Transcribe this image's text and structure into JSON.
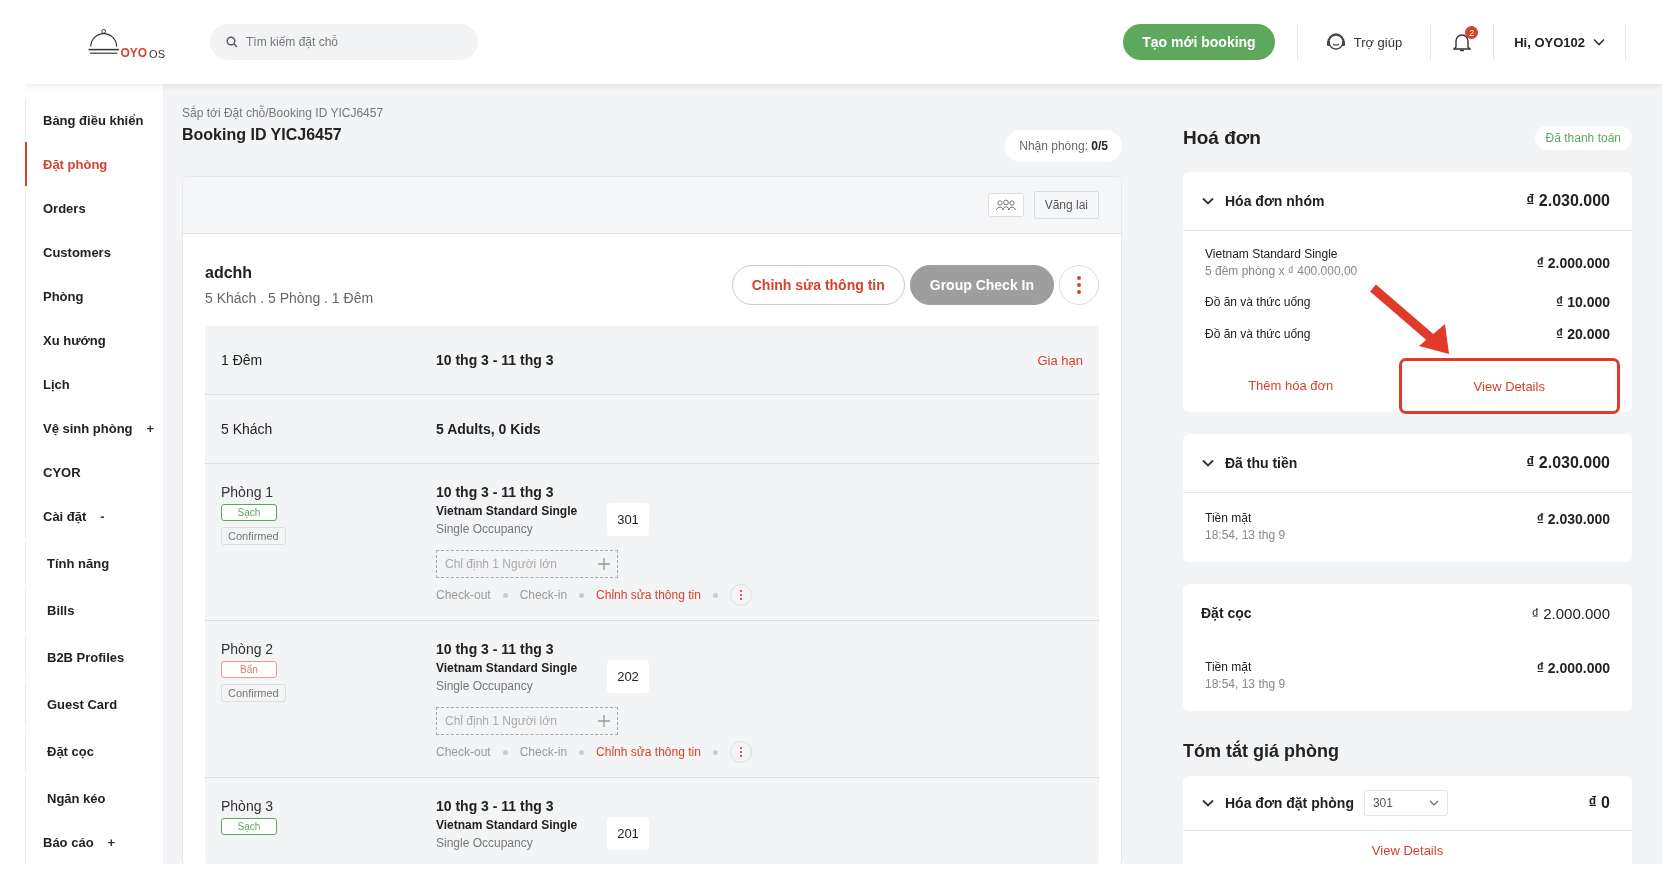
{
  "header": {
    "logo": {
      "mark": "OYO",
      "suffix": "OS"
    },
    "search": {
      "placeholder": "Tìm kiếm đặt chỗ"
    },
    "new_booking": "Tạo mới booking",
    "help": "Trợ giúp",
    "notifications": "2",
    "user": "Hi, OYO102"
  },
  "sidebar": {
    "items": [
      {
        "label": "Bảng điều khiển",
        "selected": false
      },
      {
        "label": "Đặt phòng",
        "selected": true
      },
      {
        "label": "Orders",
        "selected": false
      },
      {
        "label": "Customers",
        "selected": false
      },
      {
        "label": "Phòng",
        "selected": false
      },
      {
        "label": "Xu hướng",
        "selected": false
      },
      {
        "label": "Lịch",
        "selected": false
      },
      {
        "label": "Vệ sinh phòng",
        "selected": false,
        "expander": "+"
      },
      {
        "label": "CYOR",
        "selected": false
      },
      {
        "label": "Cài đặt",
        "selected": false,
        "expander": "-",
        "children": [
          {
            "label": "Tính năng",
            "selected": false
          },
          {
            "label": "Bills",
            "selected": false
          },
          {
            "label": "B2B Profiles",
            "selected": false
          },
          {
            "label": "Guest Card",
            "selected": false
          },
          {
            "label": "Đặt cọc",
            "selected": false
          },
          {
            "label": "Ngăn kéo",
            "selected": false
          }
        ]
      },
      {
        "label": "Báo cáo",
        "selected": false,
        "expander": "+"
      }
    ]
  },
  "booking": {
    "breadcrumb": {
      "items": [
        "Sắp tới Đặt chỗ",
        "Booking ID YICJ6457"
      ],
      "separator": "/"
    },
    "title": "Booking ID YICJ6457",
    "checkin": {
      "label": "Nhận phòng:",
      "value": "0/5"
    },
    "source": "Vãng lai",
    "guest": {
      "name": "adchh",
      "summary": "5 Khách . 5 Phòng . 1 Đêm"
    },
    "actions": [
      {
        "label": "Chỉnh sửa thông tin",
        "disabled": false
      },
      {
        "label": "Group Check In",
        "disabled": true
      }
    ],
    "stay": [
      {
        "label": "1 Đêm",
        "value": "10 thg 3 - 11 thg 3",
        "action": "Gia hạn"
      },
      {
        "label": "5 Khách",
        "value": "5 Adults, 0 Kids"
      }
    ],
    "rooms": [
      {
        "name": "Phòng 1",
        "housekeeping": {
          "label": "Sạch",
          "kind": "clean"
        },
        "status": "Confirmed",
        "dates": "10 thg 3 - 11 thg 3",
        "room_type": "Vietnam Standard Single",
        "occupancy": "Single Occupancy",
        "room_number": "301",
        "assign_placeholder": "Chỉ định 1 Người lớn",
        "actions": [
          {
            "label": "Check-out",
            "disabled": true
          },
          {
            "label": "Check-in",
            "disabled": true
          },
          {
            "label": "Chỉnh sửa thông tin",
            "disabled": false
          }
        ]
      },
      {
        "name": "Phòng 2",
        "housekeeping": {
          "label": "Bẩn",
          "kind": "dirty"
        },
        "status": "Confirmed",
        "dates": "10 thg 3 - 11 thg 3",
        "room_type": "Vietnam Standard Single",
        "occupancy": "Single Occupancy",
        "room_number": "202",
        "assign_placeholder": "Chỉ định 1 Người lớn",
        "actions": [
          {
            "label": "Check-out",
            "disabled": true
          },
          {
            "label": "Check-in",
            "disabled": true
          },
          {
            "label": "Chỉnh sửa thông tin",
            "disabled": false
          }
        ]
      },
      {
        "name": "Phòng 3",
        "housekeeping": {
          "label": "Sạch",
          "kind": "clean"
        },
        "dates": "10 thg 3 - 11 thg 3",
        "room_type": "Vietnam Standard Single",
        "occupancy": "Single Occupancy",
        "room_number": "201"
      }
    ]
  },
  "invoice": {
    "title": "Hoá đơn",
    "status": "Đã thanh toán",
    "group_bill": {
      "title": "Hóa đơn nhóm",
      "amount": "₫ 2.030.000",
      "expanded": true,
      "lines": [
        {
          "label": "Vietnam Standard Single",
          "detail": "5 đêm phòng x ₫ 400.000,00",
          "amount": "₫ 2.000.000"
        },
        {
          "label": "Đồ ăn và thức uống",
          "amount": "₫ 10.000"
        },
        {
          "label": "Đồ ăn và thức uống",
          "amount": "₫ 20.000"
        }
      ],
      "add": "Thêm hóa đơn",
      "view": {
        "label": "View Details",
        "highlighted": true
      }
    },
    "collected": {
      "title": "Đã thu tiền",
      "amount": "₫ 2.030.000",
      "expanded": true,
      "payments": [
        {
          "method": "Tiền mặt",
          "time": "18:54, 13 thg 9",
          "amount": "₫ 2.030.000"
        }
      ]
    },
    "deposit": {
      "title": "Đặt cọc",
      "amount": "₫ 2.000.000",
      "payments": [
        {
          "method": "Tiền mặt",
          "time": "18:54, 13 thg 9",
          "amount": "₫ 2.000.000"
        }
      ]
    },
    "summary": {
      "title": "Tóm tắt giá phòng",
      "bill": {
        "title": "Hóa đơn đặt phòng",
        "expanded": true,
        "room": "301",
        "amount": "₫ 0",
        "view": "View Details"
      }
    }
  }
}
